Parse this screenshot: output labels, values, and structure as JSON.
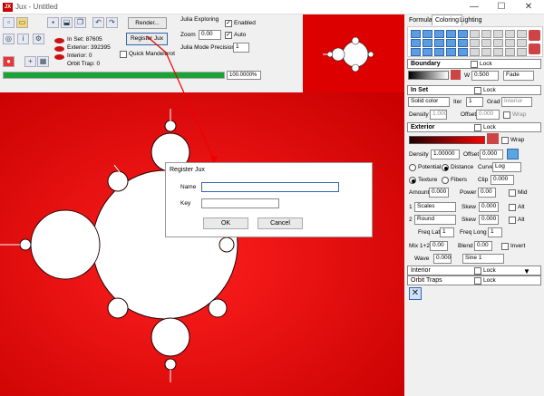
{
  "window": {
    "title": "Jux - Untitled",
    "app_icon": "JX",
    "minimize": "—",
    "maximize": "☐",
    "close": "✕"
  },
  "toolbar": {
    "render_label": "Render...",
    "register_label": "Register Jux",
    "in_set": "In Set: 87605",
    "exterior": "Exterior: 392395",
    "interior": "Interior: 0",
    "orbit_trap": "Orbit Trap: 0",
    "quick_mandelbrot": "Quick Mandelbrot",
    "progress_label": "100.0000%",
    "progress": 1.0,
    "progress_color": "#1aa336"
  },
  "julia": {
    "title": "Julia Exploring",
    "enabled_label": "Enabled",
    "zoom_label": "Zoom",
    "zoom_value": "0.00",
    "auto_label": "Auto",
    "precision_label": "Julia Mode Precision",
    "precision_value": "1"
  },
  "panel": {
    "tabs": [
      "Formula",
      "Coloring",
      "Lighting"
    ],
    "active_tab": "Coloring",
    "boundary": {
      "title": "Boundary",
      "lock": "Lock",
      "w_label": "W",
      "w_value": "0.500",
      "mode": "Fade"
    },
    "inset": {
      "title": "In Set",
      "lock": "Lock",
      "color": "Solid color",
      "iter_label": "Iter",
      "iter_value": "1",
      "grad_label": "Grad",
      "grad_value": "Interior",
      "density_label": "Density",
      "density_value": "1.000",
      "offset_label": "Offset",
      "offset_value": "0.000",
      "wrap": "Wrap"
    },
    "exterior": {
      "title": "Exterior",
      "lock": "Lock",
      "wrap": "Wrap",
      "density_label": "Density",
      "density_value": "1.00000",
      "offset_label": "Offset",
      "offset_value": "0.000",
      "potential": "Potential",
      "distance": "Distance",
      "curve_label": "Curve",
      "curve_value": "Log",
      "texture": "Texture",
      "fibers": "Fibers",
      "clip_label": "Clip",
      "clip_value": "0.000",
      "amount_label": "Amount",
      "amount_value": "0.000",
      "power_label": "Power",
      "power_value": "0.00",
      "mid": "Mid",
      "layer1": {
        "num": "1",
        "mode": "Scales",
        "skew_label": "Skew",
        "skew_value": "0.000",
        "alt": "Alt"
      },
      "layer2": {
        "num": "2",
        "mode": "Round",
        "skew_label": "Skew",
        "skew_value": "0.000",
        "alt": "Alt"
      },
      "freqlat_label": "Freq Lat",
      "freqlat_value": "1",
      "freqlong_label": "Freq Long",
      "freqlong_value": "1",
      "mix_label": "Mix 1+2",
      "mix_value": "0.00",
      "blend_label": "Blend",
      "blend_value": "0.00",
      "invert": "Invert",
      "wave_label": "Wave",
      "wave_value": "0.000",
      "wave_func": "Sine 1"
    },
    "interior": {
      "title": "Interior",
      "lock": "Lock"
    },
    "orbit_traps": {
      "title": "Orbit Traps",
      "lock": "Lock"
    }
  },
  "dialog": {
    "title": "Register Jux",
    "name_label": "Name",
    "key_label": "Key",
    "name_value": "",
    "key_value": "",
    "ok": "OK",
    "cancel": "Cancel"
  },
  "colors": {
    "fractal_bg": "#dd0000",
    "accent": "#3367b0",
    "progress": "#1aa336"
  }
}
